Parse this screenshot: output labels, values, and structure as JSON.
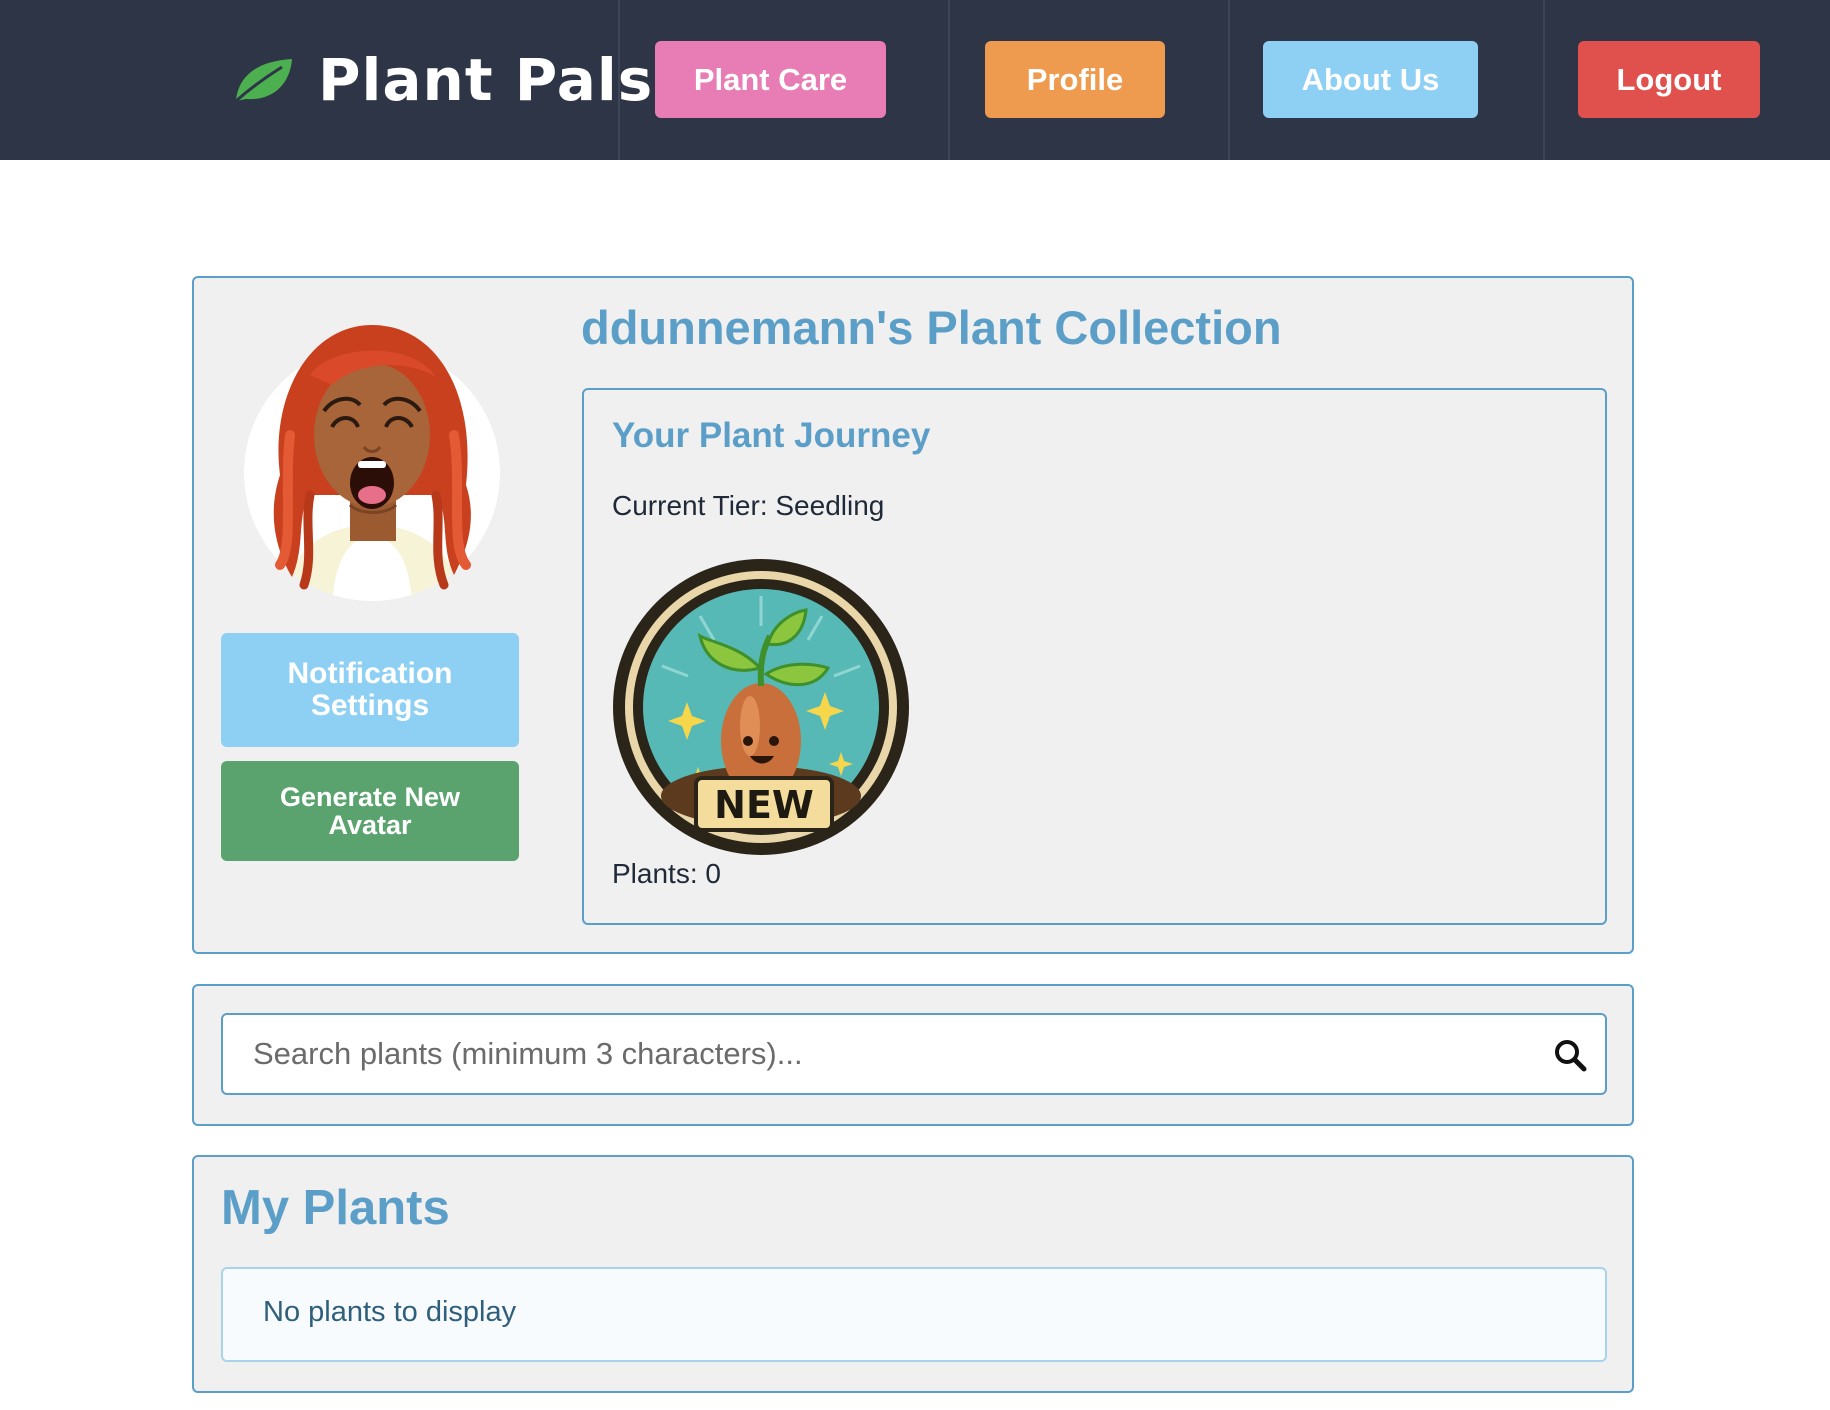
{
  "app": {
    "name": "Plant Pals",
    "accent_color": "#5b9fc8",
    "nav_background": "#2e3547"
  },
  "nav": {
    "items": [
      {
        "label": "Plant Care",
        "color": "#e87cb4"
      },
      {
        "label": "Profile",
        "color": "#ef9b4f"
      },
      {
        "label": "About Us",
        "color": "#8ecff4"
      },
      {
        "label": "Logout",
        "color": "#e0504d"
      }
    ]
  },
  "profile": {
    "collection_title": "ddunnemann's Plant Collection",
    "notification_button": "Notification Settings",
    "generate_avatar_button": "Generate New Avatar",
    "avatar_icon": "avatar-illustration"
  },
  "journey": {
    "title": "Your Plant Journey",
    "tier_text": "Current Tier: Seedling",
    "badge_label": "NEW",
    "plants_text": "Plants: 0"
  },
  "search": {
    "placeholder": "Search plants (minimum 3 characters)...",
    "icon": "search-icon"
  },
  "my_plants": {
    "title": "My Plants",
    "empty_message": "No plants to display"
  }
}
